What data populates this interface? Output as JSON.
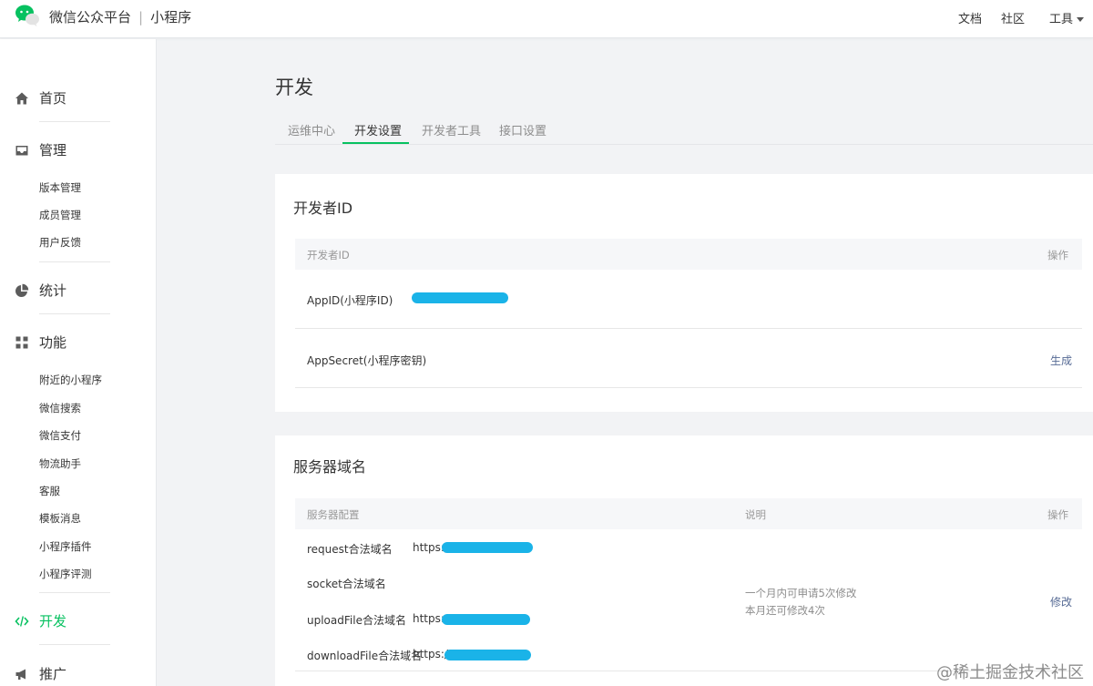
{
  "header": {
    "brand": "微信公众平台",
    "product": "小程序",
    "links": {
      "docs": "文档",
      "community": "社区",
      "tools": "工具"
    }
  },
  "sidebar": {
    "groups": {
      "home": "首页",
      "manage": "管理",
      "stats": "统计",
      "features": "功能",
      "develop": "开发",
      "promote": "推广"
    },
    "manage_items": [
      "版本管理",
      "成员管理",
      "用户反馈"
    ],
    "feature_items": [
      "附近的小程序",
      "微信搜索",
      "微信支付",
      "物流助手",
      "客服",
      "模板消息",
      "小程序插件",
      "小程序评测"
    ],
    "active": "develop",
    "active_color": "#07c160"
  },
  "main": {
    "title": "开发",
    "tabs": [
      "运维中心",
      "开发设置",
      "开发者工具",
      "接口设置"
    ],
    "active_tab": 1,
    "developer_id": {
      "title": "开发者ID",
      "columns": {
        "name": "开发者ID",
        "action": "操作"
      },
      "rows": [
        {
          "label": "AppID(小程序ID)",
          "value_redacted": true
        },
        {
          "label": "AppSecret(小程序密钥)",
          "action": "生成"
        }
      ]
    },
    "server_domains": {
      "title": "服务器域名",
      "columns": {
        "config": "服务器配置",
        "desc": "说明",
        "action": "操作"
      },
      "rows": [
        {
          "label": "request合法域名",
          "value": "https://"
        },
        {
          "label": "socket合法域名",
          "value": ""
        },
        {
          "label": "uploadFile合法域名",
          "value": "https://"
        },
        {
          "label": "downloadFile合法域名",
          "value": "https://"
        }
      ],
      "desc_lines": [
        "一个月内可申请5次修改",
        "本月还可修改4次"
      ],
      "action": "修改"
    }
  },
  "watermark": "@稀土掘金技术社区",
  "colors": {
    "accent": "#07c160",
    "link": "#576b95",
    "redaction": "#1ab3e8"
  }
}
